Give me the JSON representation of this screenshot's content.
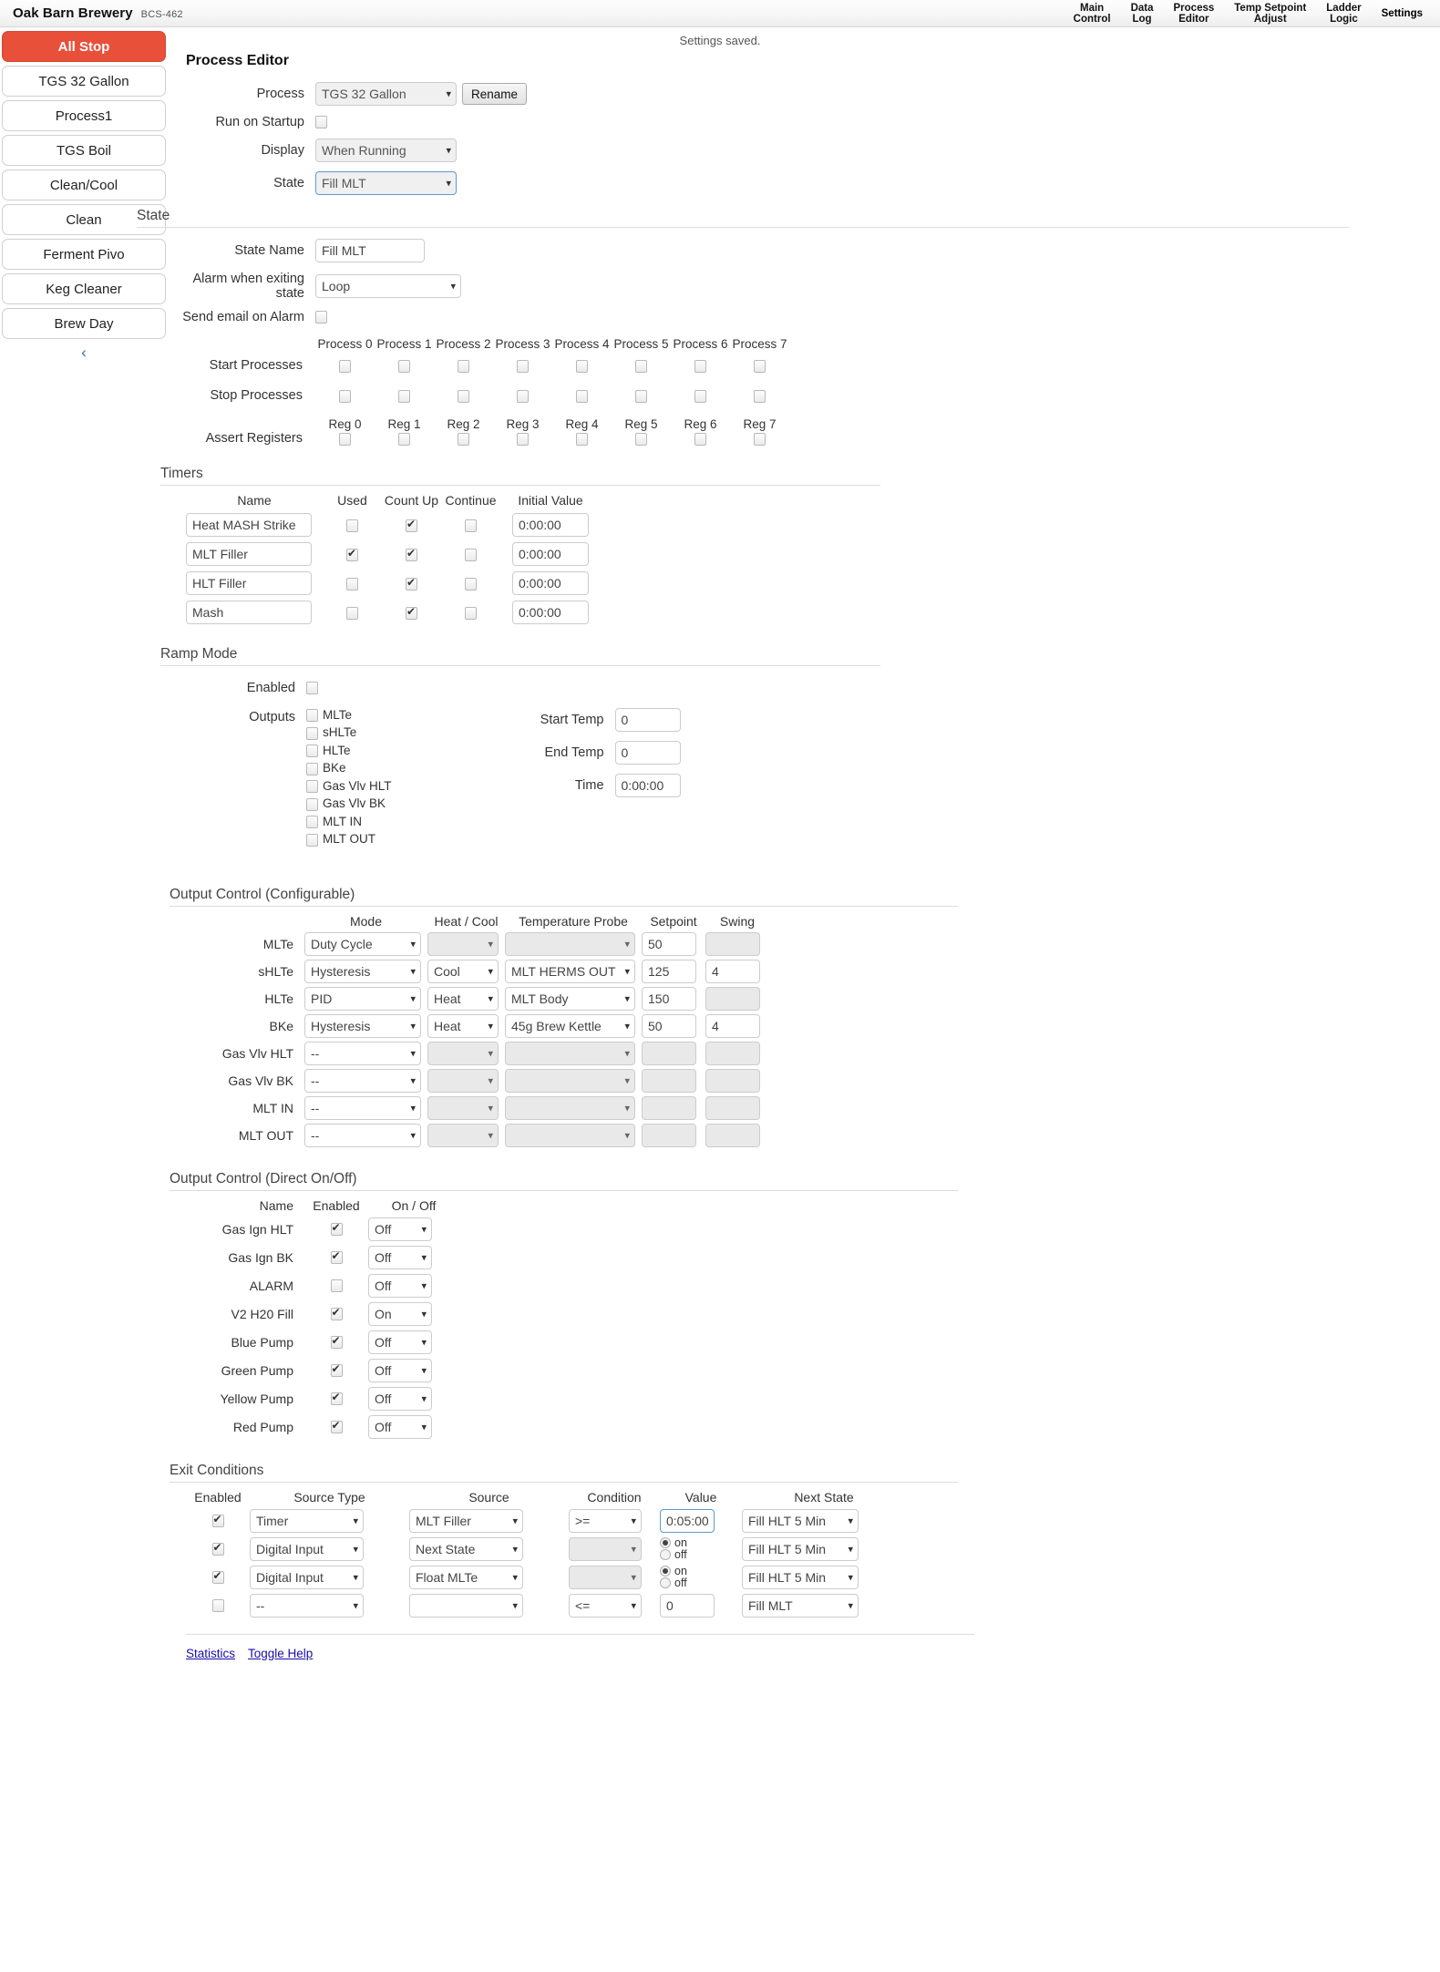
{
  "header": {
    "brand_name": "Oak Barn Brewery",
    "model": "BCS-462",
    "nav": [
      {
        "label": "Main\nControl",
        "active": false
      },
      {
        "label": "Data\nLog",
        "active": false
      },
      {
        "label": "Process\nEditor",
        "active": false
      },
      {
        "label": "Temp Setpoint\nAdjust",
        "active": false
      },
      {
        "label": "Ladder\nLogic",
        "active": false
      },
      {
        "label": "Settings",
        "active": true
      }
    ]
  },
  "sidebar": {
    "all_stop": "All Stop",
    "items": [
      {
        "label": "TGS 32 Gallon"
      },
      {
        "label": "Process1"
      },
      {
        "label": "TGS Boil"
      },
      {
        "label": "Clean/Cool"
      },
      {
        "label": "Clean"
      },
      {
        "label": "Ferment Pivo"
      },
      {
        "label": "Keg Cleaner"
      },
      {
        "label": "Brew Day"
      }
    ],
    "collapse_icon": "‹"
  },
  "status_message": "Settings saved.",
  "page_title": "Process Editor",
  "process_section": {
    "process_label": "Process",
    "process_value": "TGS 32 Gallon",
    "rename_label": "Rename",
    "run_on_startup_label": "Run on Startup",
    "run_on_startup_checked": false,
    "display_label": "Display",
    "display_value": "When Running",
    "state_label": "State",
    "state_value": "Fill MLT"
  },
  "state_section": {
    "title": "State",
    "state_name_label": "State Name",
    "state_name_value": "Fill MLT",
    "alarm_label": "Alarm when exiting state",
    "alarm_value": "Loop",
    "send_email_label": "Send email on Alarm",
    "send_email_checked": false,
    "process_columns": [
      "Process 0",
      "Process 1",
      "Process 2",
      "Process 3",
      "Process 4",
      "Process 5",
      "Process 6",
      "Process 7"
    ],
    "register_columns": [
      "Reg 0",
      "Reg 1",
      "Reg 2",
      "Reg 3",
      "Reg 4",
      "Reg 5",
      "Reg 6",
      "Reg 7"
    ],
    "start_processes_label": "Start Processes",
    "start_processes": [
      false,
      false,
      false,
      false,
      false,
      false,
      false,
      false
    ],
    "stop_processes_label": "Stop Processes",
    "stop_processes": [
      false,
      false,
      false,
      false,
      false,
      false,
      false,
      false
    ],
    "assert_registers_label": "Assert Registers",
    "assert_registers": [
      false,
      false,
      false,
      false,
      false,
      false,
      false,
      false
    ]
  },
  "timers": {
    "title": "Timers",
    "columns": [
      "Name",
      "Used",
      "Count Up",
      "Continue",
      "Initial Value"
    ],
    "rows": [
      {
        "name": "Heat MASH Strike",
        "used": false,
        "count_up": true,
        "continue": false,
        "initial_value": "0:00:00"
      },
      {
        "name": "MLT Filler",
        "used": true,
        "count_up": true,
        "continue": false,
        "initial_value": "0:00:00"
      },
      {
        "name": "HLT Filler",
        "used": false,
        "count_up": true,
        "continue": false,
        "initial_value": "0:00:00"
      },
      {
        "name": "Mash",
        "used": false,
        "count_up": true,
        "continue": false,
        "initial_value": "0:00:00"
      }
    ]
  },
  "ramp_mode": {
    "title": "Ramp Mode",
    "enabled_label": "Enabled",
    "enabled": false,
    "outputs_label": "Outputs",
    "outputs": [
      {
        "label": "MLTe",
        "checked": false
      },
      {
        "label": "sHLTe",
        "checked": false
      },
      {
        "label": "HLTe",
        "checked": false
      },
      {
        "label": "BKe",
        "checked": false
      },
      {
        "label": "Gas Vlv HLT",
        "checked": false
      },
      {
        "label": "Gas Vlv BK",
        "checked": false
      },
      {
        "label": "MLT IN",
        "checked": false
      },
      {
        "label": "MLT OUT",
        "checked": false
      }
    ],
    "start_temp_label": "Start Temp",
    "start_temp": "0",
    "end_temp_label": "End Temp",
    "end_temp": "0",
    "time_label": "Time",
    "time": "0:00:00"
  },
  "output_control_config": {
    "title": "Output Control (Configurable)",
    "columns": [
      "Mode",
      "Heat / Cool",
      "Temperature Probe",
      "Setpoint",
      "Swing"
    ],
    "rows": [
      {
        "name": "MLTe",
        "mode": "Duty Cycle",
        "heat_cool": "",
        "probe": "",
        "setpoint": "50",
        "swing": "",
        "hc_disabled": true,
        "probe_disabled": true,
        "swing_disabled": true
      },
      {
        "name": "sHLTe",
        "mode": "Hysteresis",
        "heat_cool": "Cool",
        "probe": "MLT HERMS OUT",
        "setpoint": "125",
        "swing": "4",
        "hc_disabled": false,
        "probe_disabled": false,
        "swing_disabled": false
      },
      {
        "name": "HLTe",
        "mode": "PID",
        "heat_cool": "Heat",
        "probe": "MLT Body",
        "setpoint": "150",
        "swing": "",
        "hc_disabled": false,
        "probe_disabled": false,
        "swing_disabled": true
      },
      {
        "name": "BKe",
        "mode": "Hysteresis",
        "heat_cool": "Heat",
        "probe": "45g Brew Kettle",
        "setpoint": "50",
        "swing": "4",
        "hc_disabled": false,
        "probe_disabled": false,
        "swing_disabled": false
      },
      {
        "name": "Gas Vlv HLT",
        "mode": "--",
        "heat_cool": "",
        "probe": "",
        "setpoint": "",
        "swing": "",
        "hc_disabled": true,
        "probe_disabled": true,
        "swing_disabled": true,
        "sp_disabled": true
      },
      {
        "name": "Gas Vlv BK",
        "mode": "--",
        "heat_cool": "",
        "probe": "",
        "setpoint": "",
        "swing": "",
        "hc_disabled": true,
        "probe_disabled": true,
        "swing_disabled": true,
        "sp_disabled": true
      },
      {
        "name": "MLT IN",
        "mode": "--",
        "heat_cool": "",
        "probe": "",
        "setpoint": "",
        "swing": "",
        "hc_disabled": true,
        "probe_disabled": true,
        "swing_disabled": true,
        "sp_disabled": true
      },
      {
        "name": "MLT OUT",
        "mode": "--",
        "heat_cool": "",
        "probe": "",
        "setpoint": "",
        "swing": "",
        "hc_disabled": true,
        "probe_disabled": true,
        "swing_disabled": true,
        "sp_disabled": true
      }
    ]
  },
  "output_control_direct": {
    "title": "Output Control (Direct On/Off)",
    "columns": [
      "Name",
      "Enabled",
      "On / Off"
    ],
    "rows": [
      {
        "name": "Gas Ign HLT",
        "enabled": true,
        "state": "Off"
      },
      {
        "name": "Gas Ign BK",
        "enabled": true,
        "state": "Off"
      },
      {
        "name": "ALARM",
        "enabled": false,
        "state": "Off"
      },
      {
        "name": "V2 H20 Fill",
        "enabled": true,
        "state": "On"
      },
      {
        "name": "Blue Pump",
        "enabled": true,
        "state": "Off"
      },
      {
        "name": "Green Pump",
        "enabled": true,
        "state": "Off"
      },
      {
        "name": "Yellow Pump",
        "enabled": true,
        "state": "Off"
      },
      {
        "name": "Red Pump",
        "enabled": true,
        "state": "Off"
      }
    ]
  },
  "exit_conditions": {
    "title": "Exit Conditions",
    "columns": [
      "Enabled",
      "Source Type",
      "Source",
      "Condition",
      "Value",
      "Next State"
    ],
    "on_label": "on",
    "off_label": "off",
    "rows": [
      {
        "enabled": true,
        "source_type": "Timer",
        "source": "MLT Filler",
        "condition": ">=",
        "value": "0:05:00",
        "value_kind": "text",
        "next_state": "Fill HLT 5 Min",
        "cond_disabled": false
      },
      {
        "enabled": true,
        "source_type": "Digital Input",
        "source": "Next State",
        "condition": "",
        "value_kind": "radio",
        "radio": "on",
        "next_state": "Fill HLT 5 Min",
        "cond_disabled": true
      },
      {
        "enabled": true,
        "source_type": "Digital Input",
        "source": "Float MLTe",
        "condition": "",
        "value_kind": "radio",
        "radio": "on",
        "next_state": "Fill HLT 5 Min",
        "cond_disabled": true
      },
      {
        "enabled": false,
        "source_type": "--",
        "source": "",
        "condition": "<=",
        "value": "0",
        "value_kind": "text",
        "next_state": "Fill MLT",
        "cond_disabled": false
      }
    ]
  },
  "footer": {
    "links": [
      {
        "label": "Statistics"
      },
      {
        "label": "Toggle Help"
      }
    ]
  },
  "colors": {
    "all_stop": "#e8503a",
    "link": "#1a0dab",
    "focus_border": "#5a9bd5"
  }
}
